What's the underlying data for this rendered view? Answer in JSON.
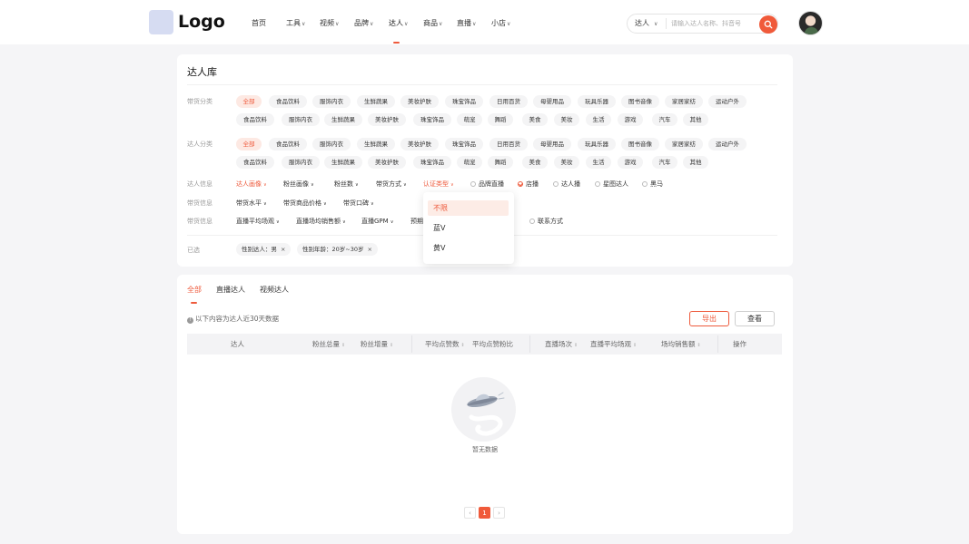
{
  "header": {
    "logo": "Logo",
    "nav": [
      {
        "label": "首页",
        "caret": false
      },
      {
        "label": "工具",
        "caret": true
      },
      {
        "label": "视频",
        "caret": true
      },
      {
        "label": "品牌",
        "caret": true
      },
      {
        "label": "达人",
        "caret": true,
        "active": true
      },
      {
        "label": "商品",
        "caret": true
      },
      {
        "label": "直播",
        "caret": true
      },
      {
        "label": "小店",
        "caret": true
      }
    ],
    "search": {
      "type_label": "达人",
      "placeholder": "请输入达人名称、抖音号"
    }
  },
  "library": {
    "title": "达人库",
    "goods_category": {
      "label": "带货分类",
      "row1": [
        "全部",
        "食品饮料",
        "服饰内衣",
        "生鲜蔬果",
        "美妆护肤",
        "珠宝饰品",
        "日用百货",
        "母婴用品",
        "玩具乐器",
        "图书音像",
        "家居家纺",
        "运动户外"
      ],
      "row2": [
        "食品饮料",
        "服饰内衣",
        "生鲜蔬果",
        "美妆护肤",
        "珠宝饰品",
        "萌宠",
        "舞蹈",
        "美食",
        "美妆",
        "生活",
        "游戏",
        "汽车",
        "其他"
      ]
    },
    "influencer_category": {
      "label": "达人分类",
      "row1": [
        "全部",
        "食品饮料",
        "服饰内衣",
        "生鲜蔬果",
        "美妆护肤",
        "珠宝饰品",
        "日用百货",
        "母婴用品",
        "玩具乐器",
        "图书音像",
        "家居家纺",
        "运动户外"
      ],
      "row2": [
        "食品饮料",
        "服饰内衣",
        "生鲜蔬果",
        "美妆护肤",
        "珠宝饰品",
        "萌宠",
        "舞蹈",
        "美食",
        "美妆",
        "生活",
        "游戏",
        "汽车",
        "其他"
      ]
    },
    "influencer_info": {
      "label": "达人信息",
      "filters": [
        "达人画像",
        "粉丝画像",
        "粉丝数",
        "带货方式",
        "认证类型"
      ],
      "checks": [
        {
          "label": "品牌直播",
          "checked": false
        },
        {
          "label": "店播",
          "checked": true
        },
        {
          "label": "达人播",
          "checked": false
        },
        {
          "label": "星图达人",
          "checked": false
        },
        {
          "label": "黑马",
          "checked": false
        }
      ]
    },
    "sales_info": {
      "label": "带货信息",
      "filters": [
        "带货水平",
        "带货商品价格",
        "带货口碑"
      ]
    },
    "live_info": {
      "label": "带货信息",
      "filters": [
        "直播平均场观",
        "直播场均销售额",
        "直播GPM",
        "预期"
      ],
      "contact": "联系方式"
    },
    "selected": {
      "label": "已选",
      "tags": [
        "性别达人：男",
        "性别年龄：20岁~30岁"
      ]
    },
    "cert_dropdown": {
      "options": [
        "不限",
        "蓝V",
        "黄V"
      ],
      "selected": "不限"
    }
  },
  "results": {
    "tabs": [
      "全部",
      "直播达人",
      "视频达人"
    ],
    "info": "以下内容为达人近30天数据",
    "export_label": "导出",
    "view_label": "查看",
    "columns": [
      "达人",
      "粉丝总量",
      "粉丝增量",
      "平均点赞数",
      "平均点赞粉比",
      "直播场次",
      "直播平均场观",
      "场均销售额",
      "操作"
    ],
    "empty_text": "暂无数据",
    "page": "1",
    "prev": "‹",
    "next": "›"
  },
  "colors": {
    "accent": "#ee5a3c",
    "chip_bg": "#f4f4f5",
    "chip_active_bg": "#fde9e3"
  }
}
